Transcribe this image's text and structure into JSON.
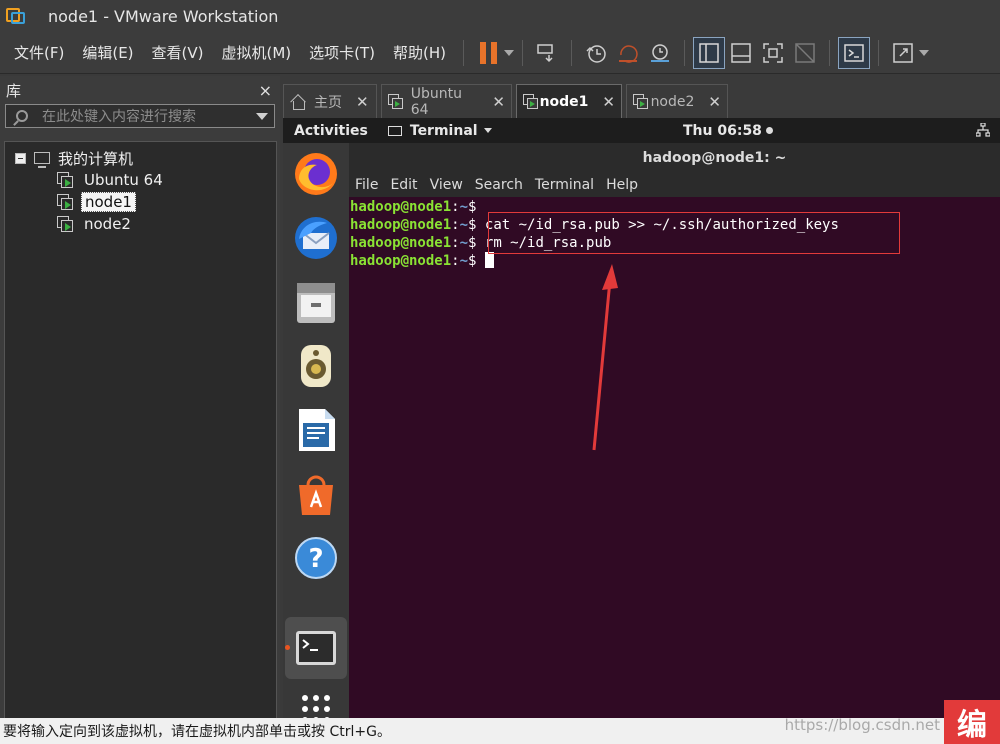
{
  "window": {
    "title": "node1 - VMware Workstation"
  },
  "menu": {
    "items": [
      "文件(F)",
      "编辑(E)",
      "查看(V)",
      "虚拟机(M)",
      "选项卡(T)",
      "帮助(H)"
    ]
  },
  "toolbar": {
    "icons": [
      "pause-icon",
      "send-keys-icon",
      "snapshot-icon",
      "revert-snapshot-icon",
      "snapshot-manager-icon",
      "sidebar-toggle-icon",
      "thumbnail-icon",
      "fullscreen-icon",
      "unity-icon",
      "console-view-icon",
      "stretch-icon"
    ],
    "accent": "#e8732a"
  },
  "library": {
    "title": "库",
    "close": "×",
    "search_placeholder": "在此处键入内容进行搜索",
    "root": "我的计算机",
    "vms": [
      "Ubuntu 64",
      "node1",
      "node2"
    ],
    "selected": "node1"
  },
  "tabs": [
    {
      "label": "主页",
      "icon": "home-icon",
      "active": false
    },
    {
      "label": "Ubuntu 64",
      "icon": "vm-icon",
      "active": false
    },
    {
      "label": "node1",
      "icon": "vm-icon",
      "active": true
    },
    {
      "label": "node2",
      "icon": "vm-icon",
      "active": false
    }
  ],
  "gnome": {
    "activities": "Activities",
    "app": "Terminal",
    "clock": "Thu 06:58"
  },
  "terminal": {
    "title": "hadoop@node1: ~",
    "menu": [
      "File",
      "Edit",
      "View",
      "Search",
      "Terminal",
      "Help"
    ],
    "lines": [
      {
        "user": "hadoop@node1",
        "path": "~",
        "cmd": ""
      },
      {
        "user": "hadoop@node1",
        "path": "~",
        "cmd": " cat ~/id_rsa.pub >> ~/.ssh/authorized_keys"
      },
      {
        "user": "hadoop@node1",
        "path": "~",
        "cmd": " rm ~/id_rsa.pub"
      },
      {
        "user": "hadoop@node1",
        "path": "~",
        "cmd": " "
      }
    ],
    "colors": {
      "background": "#300a24",
      "user": "#8ae234",
      "path": "#729fcf",
      "annotation": "#e23a3a"
    }
  },
  "dock": {
    "apps": [
      "firefox-icon",
      "thunderbird-icon",
      "files-icon",
      "rhythmbox-icon",
      "writer-icon",
      "software-icon",
      "help-icon",
      "terminal-icon",
      "show-apps-icon"
    ]
  },
  "status": {
    "text": "要将输入定向到该虚拟机，请在虚拟机内部单击或按 Ctrl+G。",
    "watermark": "https://blog.csdn.net",
    "logo_text": "编"
  }
}
